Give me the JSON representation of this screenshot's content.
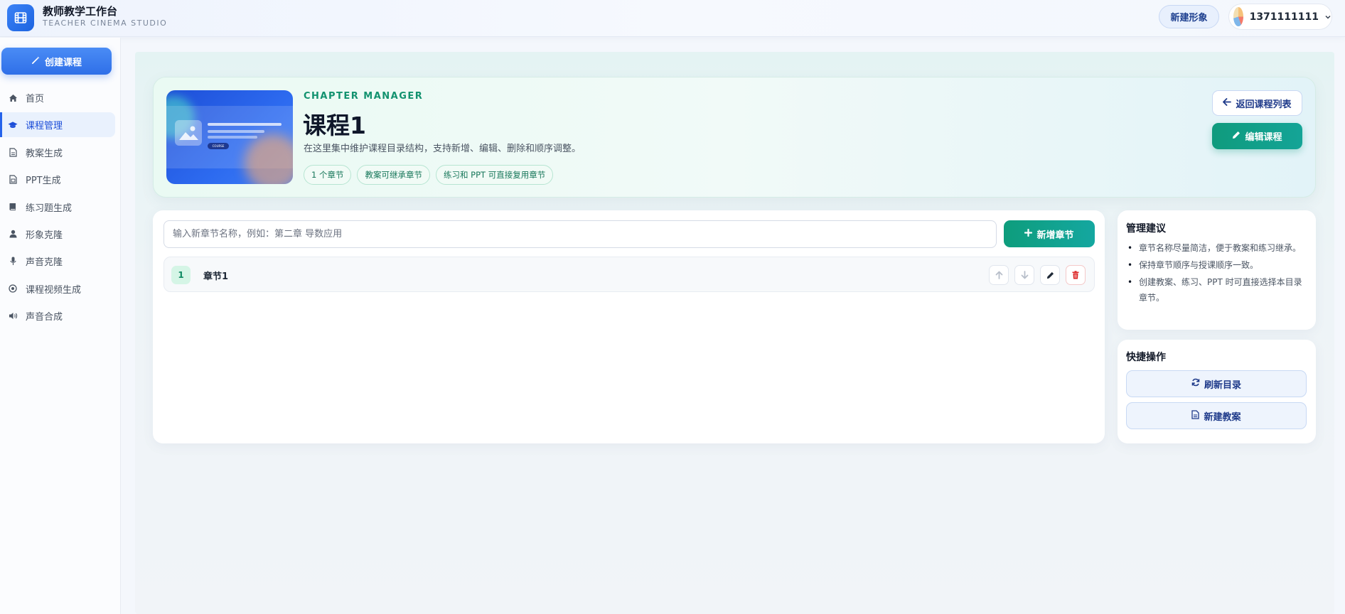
{
  "app": {
    "title": "教师教学工作台",
    "subtitle": "TEACHER CINEMA STUDIO"
  },
  "header": {
    "new_avatar_label": "新建形象",
    "user_name": "1371111111"
  },
  "sidebar": {
    "create_label": "创建课程",
    "items": [
      {
        "label": "首页",
        "icon": "home-icon"
      },
      {
        "label": "课程管理",
        "icon": "graduation-cap-icon",
        "active": true
      },
      {
        "label": "教案生成",
        "icon": "document-icon"
      },
      {
        "label": "PPT生成",
        "icon": "file-icon"
      },
      {
        "label": "练习题生成",
        "icon": "book-icon"
      },
      {
        "label": "形象克隆",
        "icon": "user-icon"
      },
      {
        "label": "声音克隆",
        "icon": "microphone-icon"
      },
      {
        "label": "课程视频生成",
        "icon": "play-circle-icon"
      },
      {
        "label": "声音合成",
        "icon": "speaker-icon"
      }
    ]
  },
  "hero": {
    "eyebrow": "CHAPTER MANAGER",
    "title": "课程1",
    "description": "在这里集中维护课程目录结构，支持新增、编辑、删除和顺序调整。",
    "tags": [
      "1 个章节",
      "教案可继承章节",
      "练习和 PPT 可直接复用章节"
    ],
    "back_label": "返回课程列表",
    "edit_label": "编辑课程",
    "cover_chip": "COURSE"
  },
  "chapters": {
    "input_value": "",
    "input_placeholder": "输入新章节名称，例如：第二章 导数应用",
    "add_label": "新增章节",
    "rows": [
      {
        "index": "1",
        "name": "章节1"
      }
    ]
  },
  "tips": {
    "title": "管理建议",
    "items": [
      "章节名称尽量简洁，便于教案和练习继承。",
      "保持章节顺序与授课顺序一致。",
      "创建教案、练习、PPT 时可直接选择本目录章节。"
    ]
  },
  "quick": {
    "title": "快捷操作",
    "refresh_label": "刷新目录",
    "new_plan_label": "新建教案"
  },
  "colors": {
    "primary": "#2f6fe8",
    "accent": "#0f9b7d",
    "danger": "#dc2626"
  }
}
